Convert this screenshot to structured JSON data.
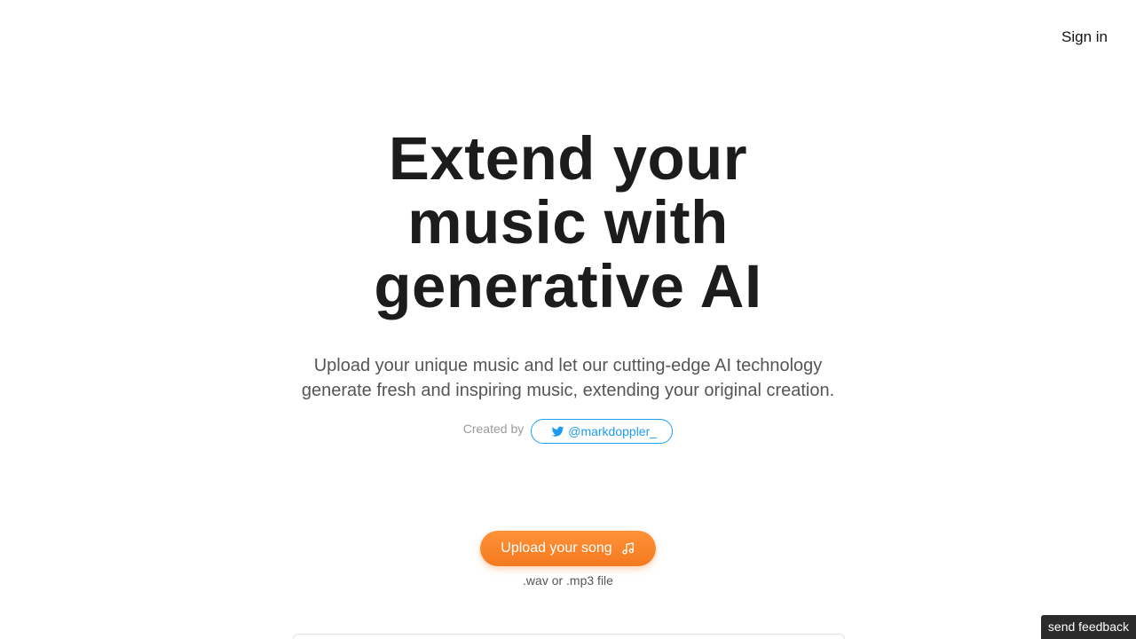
{
  "header": {
    "signin_label": "Sign in"
  },
  "hero": {
    "title_lines": [
      "Extend your",
      "music with",
      "generative AI"
    ],
    "subtitle_lines": [
      "Upload your unique music and let our cutting-edge AI technology",
      "generate fresh and inspiring music, extending your original creation."
    ]
  },
  "credit": {
    "label": "Created by",
    "handle": "@markdoppler_",
    "icon": "twitter-bird-icon",
    "color": "#1da1f2"
  },
  "upload": {
    "button_label": "Upload your song",
    "icon": "music-note-icon",
    "hint": ".wav or .mp3 file",
    "accent": "#f5791f"
  },
  "feedback": {
    "label": "send feedback"
  }
}
